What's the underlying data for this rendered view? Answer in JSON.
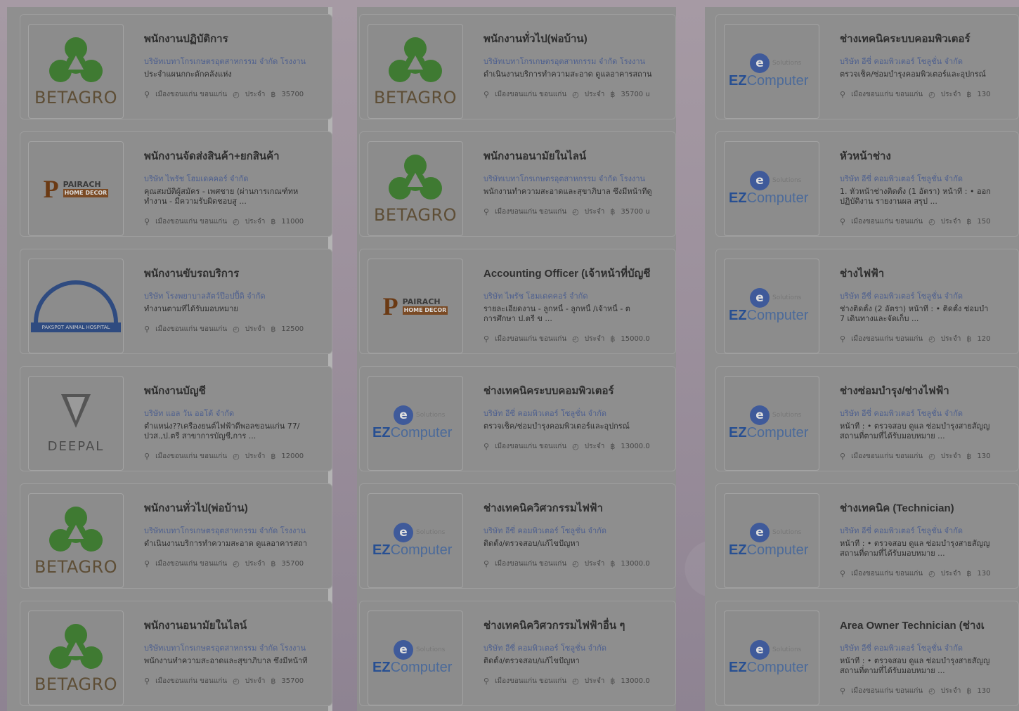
{
  "columns": [
    {
      "cards": [
        {
          "logo": "BETAGRO",
          "title": "พนักงานปฏิบัติการ",
          "company": "บริษัทเบทาโกรเกษตรอุตสาหกรรม จำกัด โรงงาน",
          "desc1": "ประจำแผนกกะดักคลังแห่ง",
          "desc2": "",
          "location": "เมืองขอนแก่น ขอนแก่น",
          "type": "ประจำ",
          "salary": "35700"
        },
        {
          "logo": "PAIRACH",
          "title": "พนักงานจัดส่งสินค้า+ยกสินค้า",
          "company": "บริษัท ไพรัช โฮมเดคคอร์ จำกัด",
          "desc1": "คุณสมบัติผู้สมัคร - เพศชาย (ผ่านการเกณฑ์ทห",
          "desc2": "ทำงาน - มีความรับผิดชอบสู ...",
          "location": "เมืองขอนแก่น ขอนแก่น",
          "type": "ประจำ",
          "salary": "11000"
        },
        {
          "logo": "TOUR",
          "title": "พนักงานขับรถบริการ",
          "company": "บริษัท โรงพยาบาลสัตว์ป๊อปปี้ดิ จำกัด",
          "desc1": "ทำงานตามที่ได้รับมอบหมาย",
          "desc2": "",
          "location": "เมืองขอนแก่น ขอนแก่น",
          "type": "ประจำ",
          "salary": "12500"
        },
        {
          "logo": "DEEPAL",
          "title": "พนักงานบัญชี",
          "company": "บริษัท แอล วัน ออโต้ จำกัด",
          "desc1": "ตำแหน่ง??เครื่องยนต์ไฟฟ้าดีพอลขอนแก่น 77/",
          "desc2": "ปวส.,ป.ตรี สาขาการบัญชี,การ ...",
          "location": "เมืองขอนแก่น ขอนแก่น",
          "type": "ประจำ",
          "salary": "12000"
        },
        {
          "logo": "BETAGRO",
          "title": "พนักงานทั่วไป(พ่อบ้าน)",
          "company": "บริษัทเบทาโกรเกษตรอุตสาหกรรม จำกัด โรงงาน",
          "desc1": "ดำเนินงานบริการทำความสะอาด ดูแลอาคารสถา",
          "desc2": "",
          "location": "เมืองขอนแก่น ขอนแก่น",
          "type": "ประจำ",
          "salary": "35700"
        },
        {
          "logo": "BETAGRO",
          "title": "พนักงานอนามัยในไลน์",
          "company": "บริษัทเบทาโกรเกษตรอุตสาหกรรม จำกัด โรงงาน",
          "desc1": "พนักงานทำความสะอาดและสุขาภิบาล ซึ่งมีหน้าที่",
          "desc2": "",
          "location": "เมืองขอนแก่น ขอนแก่น",
          "type": "ประจำ",
          "salary": "35700"
        }
      ]
    },
    {
      "cards": [
        {
          "logo": "BETAGRO",
          "title": "พนักงานทั่วไป(พ่อบ้าน)",
          "company": "บริษัทเบทาโกรเกษตรอุตสาหกรรม จำกัด โรงงาน",
          "desc1": "ดำเนินงานบริการทำความสะอาด ดูแลอาคารสถาน",
          "desc2": "",
          "location": "เมืองขอนแก่น ขอนแก่น",
          "type": "ประจำ",
          "salary": "35700 u"
        },
        {
          "logo": "BETAGRO",
          "title": "พนักงานอนามัยในไลน์",
          "company": "บริษัทเบทาโกรเกษตรอุตสาหกรรม จำกัด โรงงาน",
          "desc1": "พนักงานทำความสะอาดและสุขาภิบาล ซึ่งมีหน้าที่ดู",
          "desc2": "",
          "location": "เมืองขอนแก่น ขอนแก่น",
          "type": "ประจำ",
          "salary": "35700 u"
        },
        {
          "logo": "PAIRACH",
          "title": "Accounting Officer (เจ้าหน้าที่บัญชี",
          "company": "บริษัท ไพรัช โฮมเดคคอร์ จำกัด",
          "desc1": "รายละเอียดงาน - ลูกหนี้ - ลูกหนี้ /เจ้าหนี้ - ต",
          "desc2": "การศึกษา ป.ตรี ข ...",
          "location": "เมืองขอนแก่น ขอนแก่น",
          "type": "ประจำ",
          "salary": "15000.0"
        },
        {
          "logo": "EZ",
          "title": "ช่างเทคนิคระบบคอมพิวเตอร์",
          "company": "บริษัท อีซี่ คอมพิวเตอร์ โซลูชั่น จำกัด",
          "desc1": "ตรวจเช็ค/ซ่อมบำรุงคอมพิวเตอร์และอุปกรณ์",
          "desc2": "",
          "location": "เมืองขอนแก่น ขอนแก่น",
          "type": "ประจำ",
          "salary": "13000.0"
        },
        {
          "logo": "EZ",
          "title": "ช่างเทคนิควิศวกรรมไฟฟ้า",
          "company": "บริษัท อีซี่ คอมพิวเตอร์ โซลูชั่น จำกัด",
          "desc1": "ติดตั้ง/ตรวจสอบ/แก้ไขปัญหา",
          "desc2": "",
          "location": "เมืองขอนแก่น ขอนแก่น",
          "type": "ประจำ",
          "salary": "13000.0"
        },
        {
          "logo": "EZ",
          "title": "ช่างเทคนิควิศวกรรมไฟฟ้าอื่น ๆ",
          "company": "บริษัท อีซี่ คอมพิวเตอร์ โซลูชั่น จำกัด",
          "desc1": "ติดตั้ง/ตรวจสอบ/แก้ไขปัญหา",
          "desc2": "",
          "location": "เมืองขอนแก่น ขอนแก่น",
          "type": "ประจำ",
          "salary": "13000.0"
        }
      ]
    },
    {
      "cards": [
        {
          "logo": "EZ",
          "title": "ช่างเทคนิคระบบคอมพิวเตอร์",
          "company": "บริษัท อีซี่ คอมพิวเตอร์ โซลูชั่น จำกัด",
          "desc1": "ตรวจเช็ค/ซ่อมบำรุงคอมพิวเตอร์และอุปกรณ์",
          "desc2": "",
          "location": "เมืองขอนแก่น ขอนแก่น",
          "type": "ประจำ",
          "salary": "130"
        },
        {
          "logo": "EZ",
          "title": "หัวหน้าช่าง",
          "company": "บริษัท อีซี่ คอมพิวเตอร์ โซลูชั่น จำกัด",
          "desc1": "1. หัวหน้าช่างติดตั้ง (1 อัตรา) หน้าที่ : • ออก",
          "desc2": "ปฏิบัติงาน รายงานผล สรุป ...",
          "location": "เมืองขอนแก่น ขอนแก่น",
          "type": "ประจำ",
          "salary": "150"
        },
        {
          "logo": "EZ",
          "title": "ช่างไฟฟ้า",
          "company": "บริษัท อีซี่ คอมพิวเตอร์ โซลูชั่น จำกัด",
          "desc1": "ช่างติดตั้ง (2 อัตรา) หน้าที่ : • ติดตั้ง ซ่อมบำ",
          "desc2": "7 เดินทางและจัดเก็บ ...",
          "location": "เมืองขอนแก่น ขอนแก่น",
          "type": "ประจำ",
          "salary": "120"
        },
        {
          "logo": "EZ",
          "title": "ช่างซ่อมบำรุง/ช่างไฟฟ้า",
          "company": "บริษัท อีซี่ คอมพิวเตอร์ โซลูชั่น จำกัด",
          "desc1": "หน้าที่ : • ตรวจสอบ ดูแล ซ่อมบำรุงสายสัญญ",
          "desc2": "สถานที่ตามที่ได้รับมอบหมาย ...",
          "location": "เมืองขอนแก่น ขอนแก่น",
          "type": "ประจำ",
          "salary": "130"
        },
        {
          "logo": "EZ",
          "title": "ช่างเทคนิค (Technician)",
          "company": "บริษัท อีซี่ คอมพิวเตอร์ โซลูชั่น จำกัด",
          "desc1": "หน้าที่ : • ตรวจสอบ ดูแล ซ่อมบำรุงสายสัญญ",
          "desc2": "สถานที่ตามที่ได้รับมอบหมาย ...",
          "location": "เมืองขอนแก่น ขอนแก่น",
          "type": "ประจำ",
          "salary": "130"
        },
        {
          "logo": "EZ",
          "title": "Area Owner Technician (ช่างเ",
          "company": "บริษัท อีซี่ คอมพิวเตอร์ โซลูชั่น จำกัด",
          "desc1": "หน้าที่ : • ตรวจสอบ ดูแล ซ่อมบำรุงสายสัญญ",
          "desc2": "สถานที่ตามที่ได้รับมอบหมาย ...",
          "location": "เมืองขอนแก่น ขอนแก่น",
          "type": "ประจำ",
          "salary": "130"
        }
      ]
    }
  ],
  "logos": {
    "BETAGRO": "BETAGRO",
    "PAIRACH_word": "PAIRACH",
    "PAIRACH_sub": "HOME DECOR",
    "DEEPAL": "DEEPAL",
    "EZ_sol": "Solutions",
    "EZ_word_a": "EZ",
    "EZ_word_b": "Computer",
    "TOUR_bar": "PAKSPOT ANIMAL HOSPITAL"
  },
  "icons": {
    "location": "map-pin-icon",
    "type": "clock-icon",
    "salary": "money-icon"
  },
  "colors": {
    "background": "#8f8492",
    "card": "#8e8e8e",
    "company_link": "#4d5f8f",
    "betagro_green": "#3f7a32"
  }
}
